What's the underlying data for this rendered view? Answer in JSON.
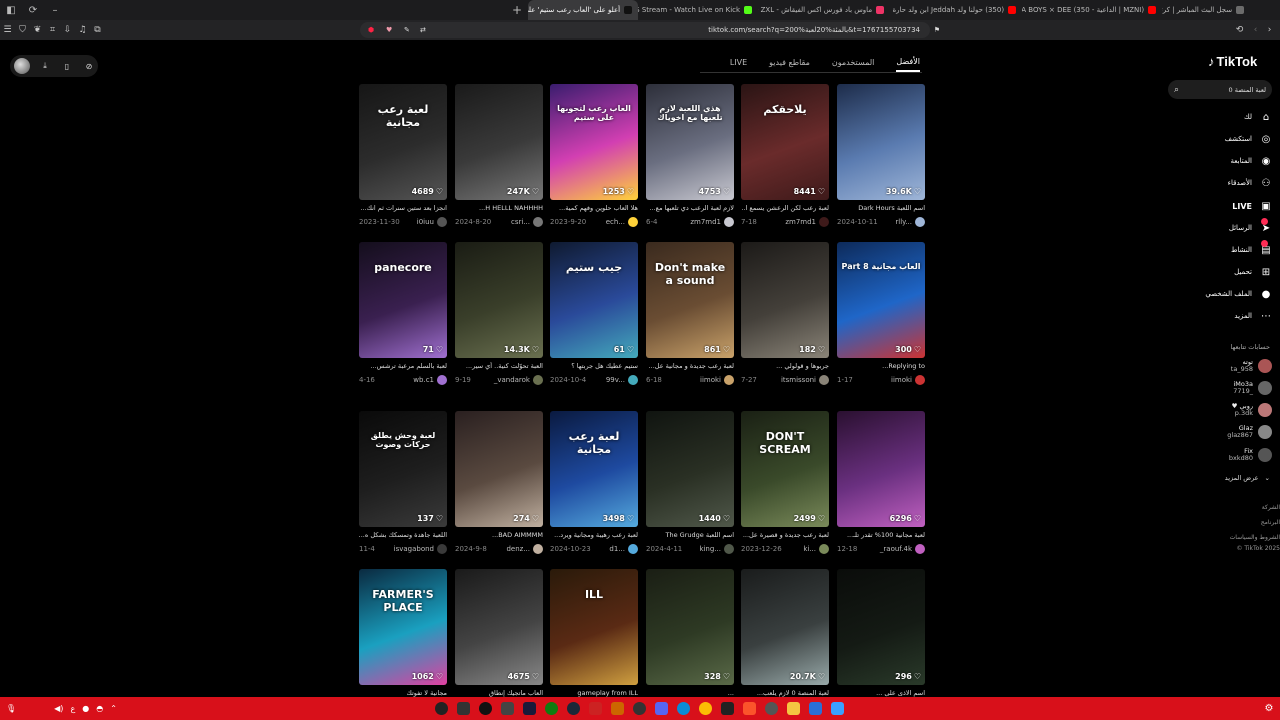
{
  "browser": {
    "tabs": [
      {
        "title": "سجل البث المباشر | كرتيون",
        "color": "#6b6b6b"
      },
      {
        "title": "(MZNI | الداعية - LA BOYS × DEE (350",
        "color": "#ff0000"
      },
      {
        "title": "(350) حولنا ولد Jeddah ابن ولد حارة ا...",
        "color": "#ff0000"
      },
      {
        "title": "ماوس باد فورس اكس الفيقاش - ZXL - دار...",
        "color": "#ee3366"
      },
      {
        "title": "JABS Stream - Watch Live on Kick",
        "color": "#53fc18"
      },
      {
        "title": "أعلو على 'العاب رعب ستيم' على...",
        "color": "#111111",
        "active": true
      }
    ],
    "url": "tiktok.com/search?q=200%بالمئة%20لعبة&t=1767155703734"
  },
  "search_tabs": [
    "الأفضل",
    "المستخدمون",
    "مقاطع فيديو",
    "LIVE"
  ],
  "sidebar": {
    "logo": "TikTok",
    "search_text": "لعبة المنصة 0",
    "nav": [
      {
        "label": "لك",
        "icon": "home-icon",
        "glyph": "⌂"
      },
      {
        "label": "استكشف",
        "icon": "compass-icon",
        "glyph": "◎"
      },
      {
        "label": "المتابعة",
        "icon": "following-icon",
        "glyph": "◉"
      },
      {
        "label": "الأصدقاء",
        "icon": "friends-icon",
        "glyph": "⚇"
      },
      {
        "label": "LIVE",
        "icon": "live-icon",
        "glyph": "▣"
      },
      {
        "label": "الرسائل",
        "icon": "messages-icon",
        "glyph": "➤"
      },
      {
        "label": "النشاط",
        "icon": "activity-icon",
        "glyph": "▤"
      },
      {
        "label": "تحميل",
        "icon": "upload-icon",
        "glyph": "⊞"
      },
      {
        "label": "الملف الشخصي",
        "icon": "profile-icon",
        "glyph": "●"
      },
      {
        "label": "المزيد",
        "icon": "more-icon",
        "glyph": "⋯"
      }
    ],
    "following_title": "حسابات تتابعها",
    "following": [
      {
        "name": "توته",
        "handle": "ta_958",
        "color": "#a55"
      },
      {
        "name": "iMo3a",
        "handle": "7719_",
        "color": "#666"
      },
      {
        "name": "♥ روبي",
        "handle": "p.3dk",
        "color": "#b77"
      },
      {
        "name": "Glaz",
        "handle": "glaz867",
        "color": "#888"
      },
      {
        "name": "Fix",
        "handle": "bxkd80",
        "color": "#555"
      }
    ],
    "see_more": "عرض المزيد",
    "footer": [
      "الشركة",
      "البرنامج",
      "الشروط والسياسات",
      "© TikTok 2025"
    ]
  },
  "videos": [
    {
      "views": "39.6K",
      "caption": "اسم اللعبة Dark Hours",
      "user": "rlly...",
      "date": "2024-10-11",
      "text": ""
    },
    {
      "views": "8441",
      "caption": "لعبة رعب لكن الرعشن يسمع ا...",
      "user": "zm7md1",
      "date": "7-18",
      "text": "يلاحقكم"
    },
    {
      "views": "4753",
      "caption": "لازم لعبة الرعب دي تلعبها مع...",
      "user": "zm7md1",
      "date": "6-4",
      "text": "هذي اللعبة لازم تلعبها مع اخوياك"
    },
    {
      "views": "1253",
      "caption": "هلا العاب حلوين وفهم كمية...",
      "user": "ech...",
      "date": "2023-9-20",
      "text": "العاب رعب لتجوبها على ستيم"
    },
    {
      "views": "247K",
      "caption": "H HELLL NAHHHH...",
      "user": "csri...",
      "date": "2024-8-20",
      "text": ""
    },
    {
      "views": "4689",
      "caption": "انجزا بعد ستين سنرات ثم انك...",
      "user": "i0iuu",
      "date": "2023-11-30",
      "text": "لعبة رعب مجانية"
    },
    {
      "views": "300",
      "caption": "Replying to...",
      "user": "iimoki",
      "date": "1-17",
      "text": "Part 8 العاب مجانية"
    },
    {
      "views": "182",
      "caption": "جربوها و قولولي ...",
      "user": "itsmissoni",
      "date": "7-27",
      "text": ""
    },
    {
      "views": "861",
      "caption": "لعبة رعب جديدة و مجانية عل...",
      "user": "iimoki",
      "date": "6-18",
      "text": "Don't make a sound"
    },
    {
      "views": "61",
      "caption": "ستيم عطيك هل جربتها ؟",
      "user": "99v...",
      "date": "2024-10-4",
      "text": "جيب ستيم"
    },
    {
      "views": "14.3K",
      "caption": "العبة تحوّلت كنية.. أي سير...",
      "user": "_vandarok",
      "date": "9-19",
      "text": ""
    },
    {
      "views": "71",
      "caption": "لعبة بالسلم مرعبة ترشس...",
      "user": "wb.c1",
      "date": "4-16",
      "text": "panecore"
    },
    {
      "views": "6296",
      "caption": "لعبة مجانية 100% تقدر تلـ...",
      "user": "_raouf.4k",
      "date": "12-18",
      "text": ""
    },
    {
      "views": "2499",
      "caption": "لعبة رعب جديدة و قصيرة عل...",
      "user": "ki...",
      "date": "2023-12-26",
      "text": "DON'T SCREAM"
    },
    {
      "views": "1440",
      "caption": "اسم اللعبة The Grudge",
      "user": "king...",
      "date": "2024-4-11",
      "text": ""
    },
    {
      "views": "3498",
      "caption": "لعبة رعب رهيبة ومجانية ويرد...",
      "user": "d1...",
      "date": "2024-10-23",
      "text": "لعبة رعب مجانية"
    },
    {
      "views": "274",
      "caption": "BAD AIMMMM...",
      "user": "denz...",
      "date": "2024-9-8",
      "text": ""
    },
    {
      "views": "137",
      "caption": "اللعبة جاهدة وتمسكك بشكل ه...",
      "user": "isvagabond",
      "date": "11-4",
      "text": "لعبة وحش يطلق حركات وصوت"
    },
    {
      "views": "296",
      "caption": "اسم الاذى على ...",
      "user": "",
      "date": "",
      "text": ""
    },
    {
      "views": "20.7K",
      "caption": "لعبة المنصة 0 لازم يلعب...",
      "user": "",
      "date": "",
      "text": ""
    },
    {
      "views": "328",
      "caption": "...",
      "user": "",
      "date": "",
      "text": ""
    },
    {
      "views": "",
      "caption": "gameplay from ILL",
      "user": "",
      "date": "",
      "text": "ILL"
    },
    {
      "views": "4675",
      "caption": "العاب ماتجيك إنطاق",
      "user": "",
      "date": "",
      "text": ""
    },
    {
      "views": "1062",
      "caption": "مجانية لا تفوتك",
      "user": "",
      "date": "",
      "text": "FARMER'S PLACE"
    }
  ],
  "taskbar_time": "٥:٣٦ ص\n٢٠٢٥/١٢/٣١"
}
